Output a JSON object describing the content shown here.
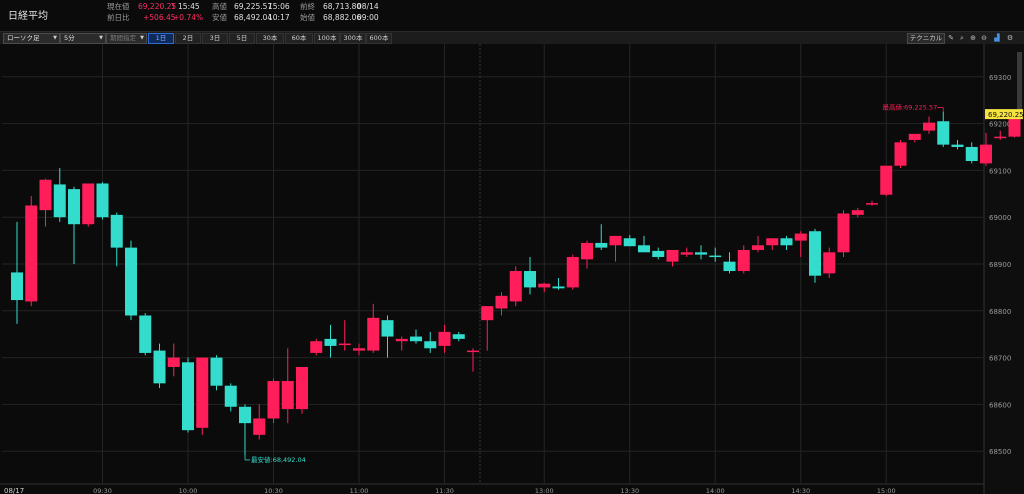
{
  "header": {
    "title": "日経平均",
    "current_label": "現在値",
    "current_value": "69,220.25",
    "current_flag": "T",
    "current_time": "15:45",
    "change_label": "前日比",
    "change_value": "+506.45",
    "change_pct": "+0.74%",
    "high_label": "高値",
    "high_value": "69,225.57",
    "high_time": "15:06",
    "low_label": "安値",
    "low_value": "68,492.04",
    "low_time": "10:17",
    "prev_close_label": "前終",
    "prev_close_value": "68,713.80",
    "prev_close_date": "08/14",
    "open_label": "始値",
    "open_value": "68,882.06",
    "open_time": "09:00"
  },
  "toolbar": {
    "chart_type": "ローソク足",
    "interval": "5分",
    "period_select": "期間指定",
    "ranges": [
      "1日",
      "2日",
      "3日",
      "5日",
      "30本",
      "60本",
      "100本",
      "300本",
      "600本"
    ],
    "active_range": "1日",
    "technical_label": "テクニカル",
    "icons": [
      "pencil-icon",
      "magnifier-icon",
      "zoom-in-icon",
      "zoom-out-icon",
      "chart-style-icon",
      "settings-icon"
    ]
  },
  "colors": {
    "up": "#ff1e5a",
    "down": "#33dccc",
    "background": "#0b0b0b",
    "grid": "#242424",
    "price_tag": "#f5e342"
  },
  "chart_data": {
    "type": "candlestick",
    "date_label": "08/17",
    "x_tick_labels": [
      "09:30",
      "10:00",
      "10:30",
      "11:00",
      "11:30",
      "13:00",
      "13:30",
      "14:00",
      "14:30",
      "15:00"
    ],
    "ylim": [
      68430,
      69370
    ],
    "y_ticks": [
      68500,
      68600,
      68700,
      68800,
      68900,
      69000,
      69100,
      69200,
      69300
    ],
    "y_tick_labels": [
      "68500",
      "68600",
      "68700",
      "68800",
      "68900",
      "69000",
      "69100",
      "69200",
      "69300"
    ],
    "current_price_label": "69,220.25",
    "current_price": 69220.25,
    "high_annotation": "最高値:69,225.57",
    "high_annotation_value": 69225.57,
    "low_annotation": "最安値:68,492.04",
    "low_annotation_value": 68492.04,
    "candles": [
      {
        "o": 68882,
        "h": 68990,
        "l": 68772,
        "c": 68823
      },
      {
        "o": 68820,
        "h": 69045,
        "l": 68810,
        "c": 69025
      },
      {
        "o": 69015,
        "h": 69082,
        "l": 68980,
        "c": 69080
      },
      {
        "o": 69070,
        "h": 69105,
        "l": 68990,
        "c": 69000
      },
      {
        "o": 69060,
        "h": 69065,
        "l": 68900,
        "c": 68985
      },
      {
        "o": 68985,
        "h": 69060,
        "l": 68980,
        "c": 69072
      },
      {
        "o": 69072,
        "h": 69075,
        "l": 68995,
        "c": 69000
      },
      {
        "o": 69005,
        "h": 69010,
        "l": 68895,
        "c": 68935
      },
      {
        "o": 68935,
        "h": 68950,
        "l": 68780,
        "c": 68790
      },
      {
        "o": 68790,
        "h": 68795,
        "l": 68705,
        "c": 68710
      },
      {
        "o": 68715,
        "h": 68730,
        "l": 68635,
        "c": 68645
      },
      {
        "o": 68680,
        "h": 68730,
        "l": 68660,
        "c": 68700
      },
      {
        "o": 68690,
        "h": 68700,
        "l": 68540,
        "c": 68545
      },
      {
        "o": 68550,
        "h": 68700,
        "l": 68535,
        "c": 68700
      },
      {
        "o": 68700,
        "h": 68705,
        "l": 68630,
        "c": 68640
      },
      {
        "o": 68640,
        "h": 68645,
        "l": 68585,
        "c": 68595
      },
      {
        "o": 68595,
        "h": 68600,
        "l": 68492,
        "c": 68560
      },
      {
        "o": 68535,
        "h": 68600,
        "l": 68525,
        "c": 68570
      },
      {
        "o": 68570,
        "h": 68655,
        "l": 68560,
        "c": 68650
      },
      {
        "o": 68590,
        "h": 68720,
        "l": 68560,
        "c": 68650
      },
      {
        "o": 68590,
        "h": 68675,
        "l": 68580,
        "c": 68680
      },
      {
        "o": 68710,
        "h": 68740,
        "l": 68705,
        "c": 68735
      },
      {
        "o": 68740,
        "h": 68770,
        "l": 68700,
        "c": 68725
      },
      {
        "o": 68730,
        "h": 68780,
        "l": 68715,
        "c": 68730
      },
      {
        "o": 68715,
        "h": 68730,
        "l": 68705,
        "c": 68720
      },
      {
        "o": 68715,
        "h": 68815,
        "l": 68710,
        "c": 68785
      },
      {
        "o": 68780,
        "h": 68790,
        "l": 68700,
        "c": 68745
      },
      {
        "o": 68735,
        "h": 68745,
        "l": 68715,
        "c": 68740
      },
      {
        "o": 68745,
        "h": 68760,
        "l": 68730,
        "c": 68735
      },
      {
        "o": 68735,
        "h": 68755,
        "l": 68710,
        "c": 68720
      },
      {
        "o": 68725,
        "h": 68770,
        "l": 68710,
        "c": 68755
      },
      {
        "o": 68750,
        "h": 68755,
        "l": 68735,
        "c": 68740
      },
      {
        "o": 68715,
        "h": 68720,
        "l": 68670,
        "c": 68715
      },
      {
        "o": 68780,
        "h": 68790,
        "l": 68715,
        "c": 68810
      },
      {
        "o": 68805,
        "h": 68840,
        "l": 68790,
        "c": 68832
      },
      {
        "o": 68820,
        "h": 68895,
        "l": 68810,
        "c": 68885
      },
      {
        "o": 68885,
        "h": 68915,
        "l": 68835,
        "c": 68850
      },
      {
        "o": 68850,
        "h": 68860,
        "l": 68840,
        "c": 68858
      },
      {
        "o": 68852,
        "h": 68870,
        "l": 68845,
        "c": 68848
      },
      {
        "o": 68850,
        "h": 68920,
        "l": 68845,
        "c": 68915
      },
      {
        "o": 68910,
        "h": 68950,
        "l": 68890,
        "c": 68945
      },
      {
        "o": 68945,
        "h": 68985,
        "l": 68930,
        "c": 68935
      },
      {
        "o": 68940,
        "h": 68960,
        "l": 68905,
        "c": 68960
      },
      {
        "o": 68955,
        "h": 68962,
        "l": 68945,
        "c": 68938
      },
      {
        "o": 68940,
        "h": 68960,
        "l": 68930,
        "c": 68925
      },
      {
        "o": 68928,
        "h": 68935,
        "l": 68910,
        "c": 68915
      },
      {
        "o": 68905,
        "h": 68930,
        "l": 68895,
        "c": 68930
      },
      {
        "o": 68920,
        "h": 68935,
        "l": 68915,
        "c": 68925
      },
      {
        "o": 68925,
        "h": 68940,
        "l": 68910,
        "c": 68920
      },
      {
        "o": 68918,
        "h": 68935,
        "l": 68905,
        "c": 68915
      },
      {
        "o": 68905,
        "h": 68925,
        "l": 68880,
        "c": 68885
      },
      {
        "o": 68885,
        "h": 68940,
        "l": 68880,
        "c": 68930
      },
      {
        "o": 68930,
        "h": 68960,
        "l": 68925,
        "c": 68940
      },
      {
        "o": 68940,
        "h": 68955,
        "l": 68930,
        "c": 68955
      },
      {
        "o": 68955,
        "h": 68960,
        "l": 68930,
        "c": 68940
      },
      {
        "o": 68950,
        "h": 68970,
        "l": 68915,
        "c": 68965
      },
      {
        "o": 68970,
        "h": 68975,
        "l": 68860,
        "c": 68875
      },
      {
        "o": 68880,
        "h": 68935,
        "l": 68870,
        "c": 68925
      },
      {
        "o": 68925,
        "h": 69015,
        "l": 68915,
        "c": 69008
      },
      {
        "o": 69005,
        "h": 69020,
        "l": 69000,
        "c": 69015
      },
      {
        "o": 69030,
        "h": 69035,
        "l": 69025,
        "c": 69030
      },
      {
        "o": 69048,
        "h": 69100,
        "l": 69045,
        "c": 69110
      },
      {
        "o": 69110,
        "h": 69165,
        "l": 69105,
        "c": 69160
      },
      {
        "o": 69165,
        "h": 69178,
        "l": 69160,
        "c": 69178
      },
      {
        "o": 69185,
        "h": 69215,
        "l": 69178,
        "c": 69202
      },
      {
        "o": 69205,
        "h": 69225.57,
        "l": 69150,
        "c": 69155
      },
      {
        "o": 69155,
        "h": 69165,
        "l": 69145,
        "c": 69150
      },
      {
        "o": 69150,
        "h": 69160,
        "l": 69115,
        "c": 69120
      },
      {
        "o": 69115,
        "h": 69180,
        "l": 69110,
        "c": 69155
      },
      {
        "o": 69170,
        "h": 69185,
        "l": 69165,
        "c": 69172
      },
      {
        "o": 69172,
        "h": 69225,
        "l": 69170,
        "c": 69220.25
      }
    ]
  }
}
